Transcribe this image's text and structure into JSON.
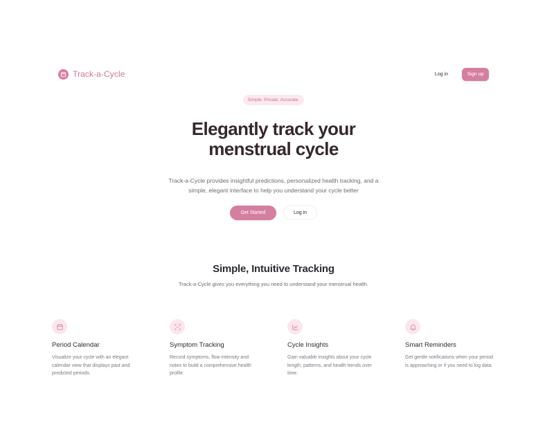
{
  "header": {
    "brand": "Track-a-Cycle",
    "login": "Log in",
    "signup": "Sign up"
  },
  "hero": {
    "badge": "Simple. Private. Accurate.",
    "title_line1": "Elegantly track your",
    "title_line2": "menstrual cycle",
    "subtitle_line1": "Track-a-Cycle provides insightful predictions, personalized health tracking, and a",
    "subtitle_line2": "simple, elegant interface to help you understand your cycle better",
    "cta_primary": "Get Started",
    "cta_secondary": "Log in"
  },
  "section": {
    "title": "Simple, Intuitive Tracking",
    "subtitle": "Track-a-Cycle gives you everything you need to understand your menstrual health."
  },
  "features": [
    {
      "icon": "calendar-icon",
      "title": "Period Calendar",
      "desc": "Visualize your cycle with an elegant calendar view that displays past and predicted periods."
    },
    {
      "icon": "scan-icon",
      "title": "Symptom Tracking",
      "desc": "Record symptoms, flow intensity and notes to build a comprehensive health profile."
    },
    {
      "icon": "chart-line-icon",
      "title": "Cycle Insights",
      "desc": "Gain valuable insights about your cycle length, patterns, and health trends over time."
    },
    {
      "icon": "bell-icon",
      "title": "Smart Reminders",
      "desc": "Get gentle notifications when your period is approaching or if you need to log data."
    }
  ],
  "colors": {
    "accent": "#d47f9f",
    "accent_light": "#fbe9ef",
    "text": "#2b2a2e",
    "muted": "#6c6a70"
  }
}
